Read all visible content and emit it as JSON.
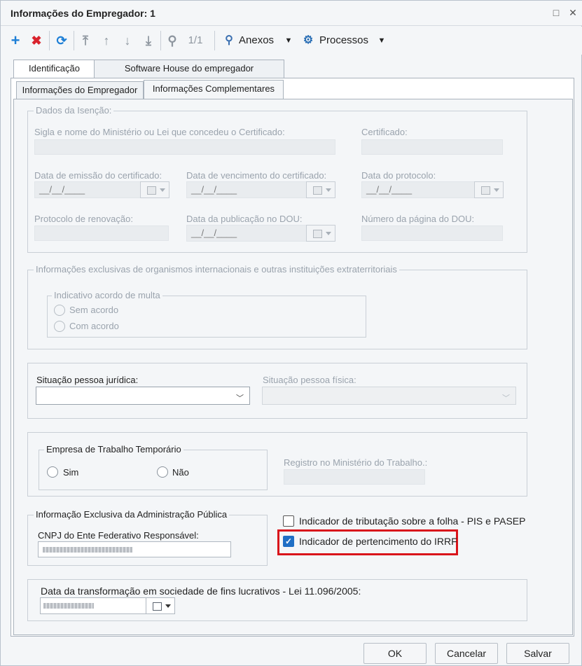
{
  "window": {
    "title": "Informações do Empregador: 1",
    "restore_glyph": "□",
    "close_glyph": "✕"
  },
  "toolbar": {
    "nav_count": "1/1",
    "anexos_label": "Anexos",
    "processos_label": "Processos"
  },
  "tabs": {
    "top": [
      "Identificação",
      "Software House do empregador"
    ],
    "sub": [
      "Informações do Empregador",
      "Informações Complementares"
    ]
  },
  "isencao": {
    "legend": "Dados da Isenção:",
    "sigla_label": "Sigla e nome do Ministério ou Lei que concedeu o Certificado:",
    "certificado_label": "Certificado:",
    "emissao_label": "Data de emissão do certificado:",
    "vencimento_label": "Data de vencimento do certificado:",
    "protocolo_label": "Data do protocolo:",
    "renovacao_label": "Protocolo de renovação:",
    "dou_label": "Data da publicação no DOU:",
    "pagina_label": "Número da página do DOU:",
    "date_mask": "__/__/____"
  },
  "organismos": {
    "legend": "Informações exclusivas de organismos internacionais e outras instituições extraterritoriais",
    "acordo_legend": "Indicativo acordo de multa",
    "sem_acordo": "Sem acordo",
    "com_acordo": "Com acordo"
  },
  "situacao": {
    "juridica_label": "Situação pessoa jurídica:",
    "fisica_label": "Situação pessoa física:"
  },
  "temporario": {
    "legend": "Empresa de Trabalho Temporário",
    "sim": "Sim",
    "nao": "Não",
    "registro_label": "Registro no Ministério do Trabalho.:"
  },
  "adm_publica": {
    "legend": "Informação Exclusiva da Administração Pública",
    "cnpj_label": "CNPJ do Ente Federativo Responsável:"
  },
  "indicadores": {
    "pis_pasep": "Indicador de tributação sobre a folha - PIS e PASEP",
    "irrf": "Indicador de pertencimento do IRRF",
    "pis_checked": false,
    "irrf_checked": true
  },
  "transformacao": {
    "label": "Data da transformação em sociedade de fins lucrativos - Lei 11.096/2005:"
  },
  "footer": {
    "ok": "OK",
    "cancelar": "Cancelar",
    "salvar": "Salvar"
  },
  "colors": {
    "highlight": "#d9141b",
    "check": "#1f6fc5",
    "add": "#1e7fd6",
    "delete": "#d9232d"
  }
}
